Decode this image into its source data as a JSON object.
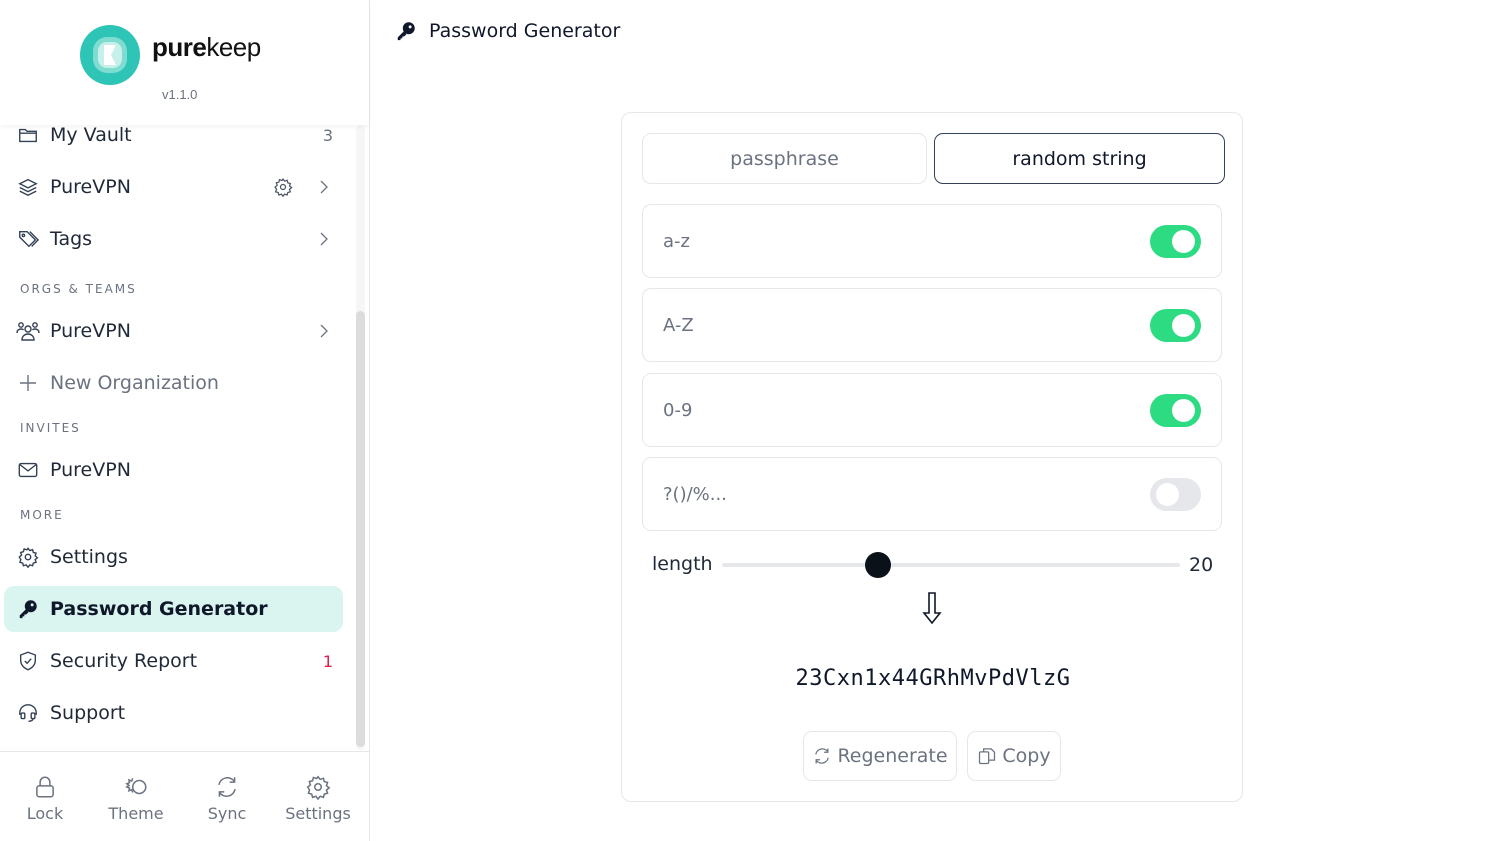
{
  "brand": {
    "name_bold": "pure",
    "name_light": "keep",
    "version": "v1.1.0",
    "logo_color": "#2ec4b6"
  },
  "sidebar": {
    "items": [
      {
        "label": "My Vault",
        "icon": "folder-icon",
        "count": "3"
      },
      {
        "label": "PureVPN",
        "icon": "layers-icon",
        "has_settings": true,
        "has_chevron": true
      },
      {
        "label": "Tags",
        "icon": "tag-icon",
        "has_chevron": true
      }
    ],
    "sections": {
      "orgs": "ORGS & TEAMS",
      "invites": "INVITES",
      "more": "MORE"
    },
    "orgs_items": [
      {
        "label": "PureVPN",
        "icon": "users-icon",
        "has_chevron": true
      },
      {
        "label": "New Organization",
        "icon": "plus-icon"
      }
    ],
    "invites_items": [
      {
        "label": "PureVPN",
        "icon": "mail-icon"
      }
    ],
    "more_items": [
      {
        "label": "Settings",
        "icon": "gear-icon"
      },
      {
        "label": "Password Generator",
        "icon": "key-icon",
        "active": true
      },
      {
        "label": "Security Report",
        "icon": "shield-check-icon",
        "count": "1"
      },
      {
        "label": "Support",
        "icon": "headset-icon"
      }
    ],
    "active_color": "#daf4f0",
    "alert_color": "#e11d48"
  },
  "bottom_bar": [
    {
      "label": "Lock",
      "icon": "lock-icon"
    },
    {
      "label": "Theme",
      "icon": "theme-icon"
    },
    {
      "label": "Sync",
      "icon": "sync-icon"
    },
    {
      "label": "Settings",
      "icon": "gear-icon"
    }
  ],
  "header": {
    "title": "Password Generator",
    "icon": "key-icon"
  },
  "generator": {
    "modes": [
      {
        "label": "passphrase",
        "selected": false
      },
      {
        "label": "random string",
        "selected": true
      }
    ],
    "options": [
      {
        "label": "a-z",
        "enabled": true
      },
      {
        "label": "A-Z",
        "enabled": true
      },
      {
        "label": "0-9",
        "enabled": true
      },
      {
        "label": "?()/%...",
        "enabled": false
      }
    ],
    "length_label": "length",
    "length_value": "20",
    "length_fraction": 0.34,
    "password": "23Cxn1x44GRhMvPdVlzG",
    "regenerate_label": "Regenerate",
    "copy_label": "Copy",
    "toggle_on_color": "#2ddc82"
  }
}
